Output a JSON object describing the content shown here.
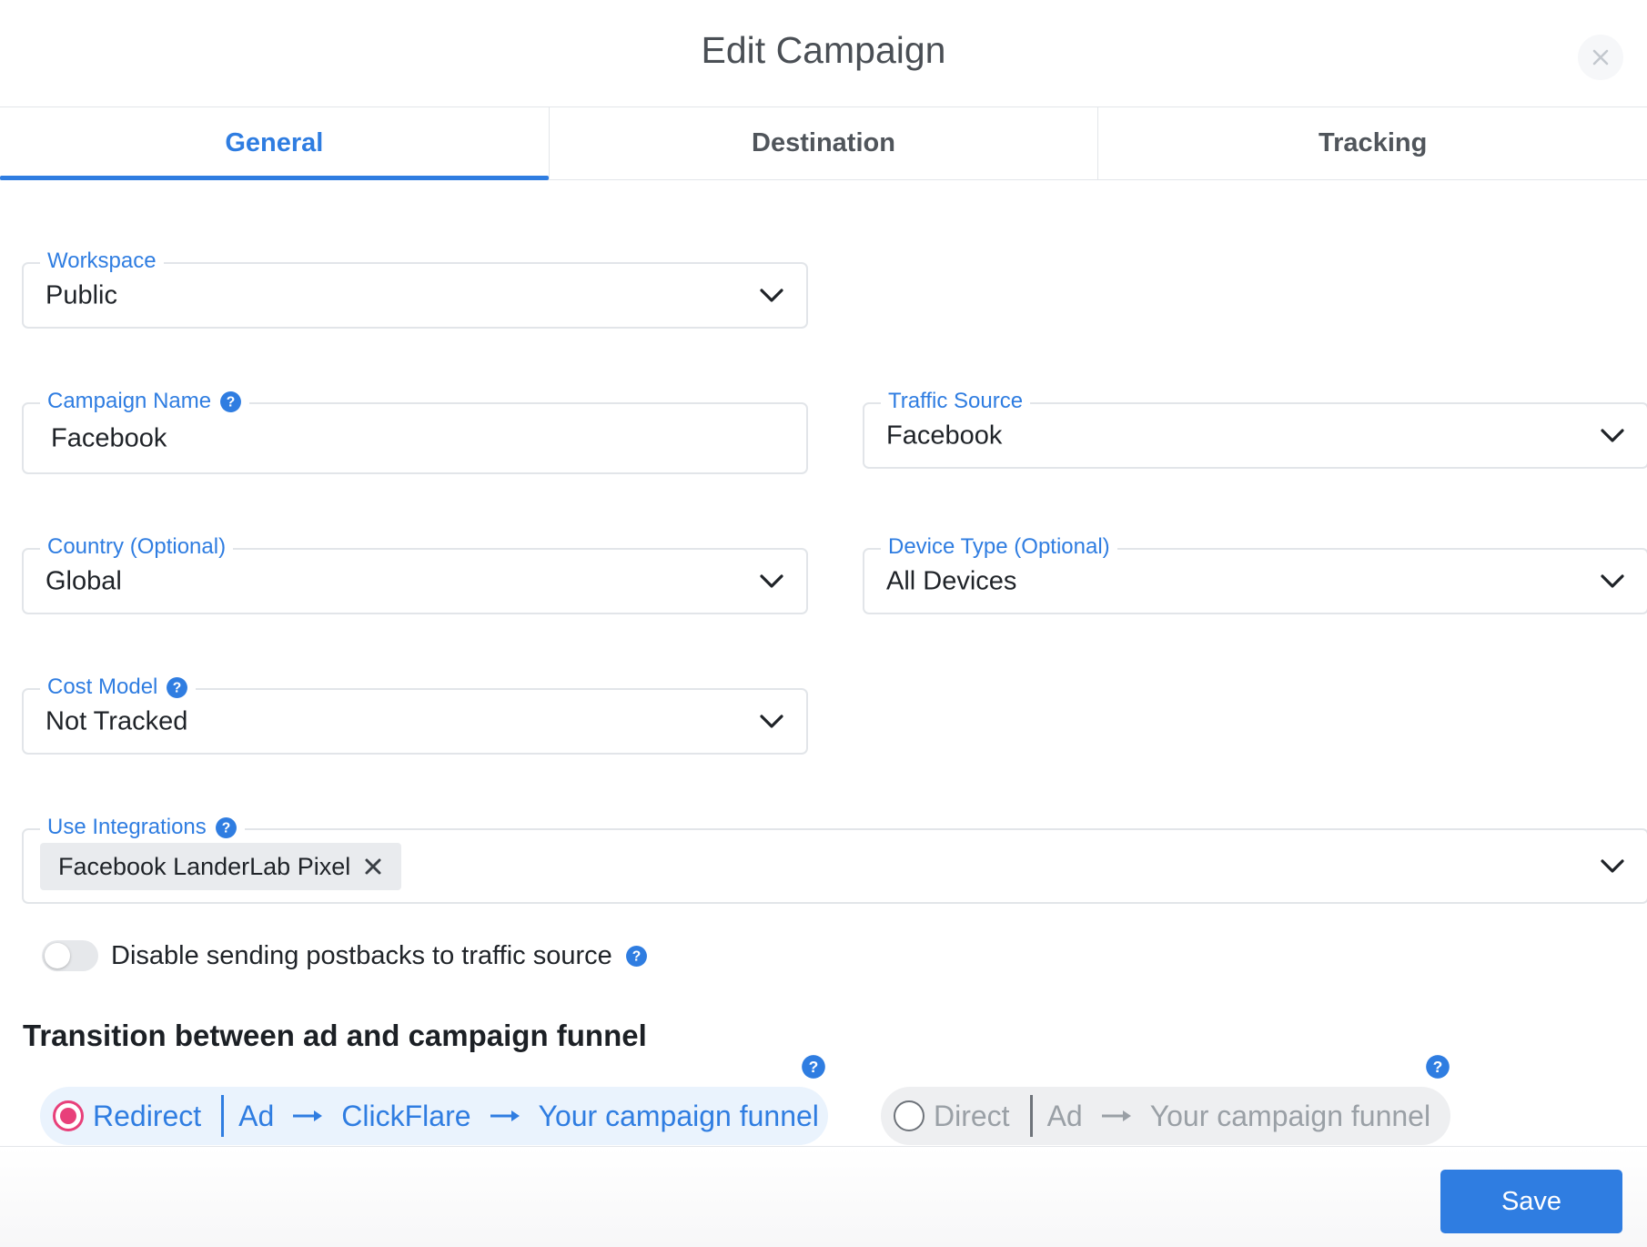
{
  "modal": {
    "title": "Edit Campaign"
  },
  "tabs": [
    {
      "label": "General",
      "active": true
    },
    {
      "label": "Destination",
      "active": false
    },
    {
      "label": "Tracking",
      "active": false
    }
  ],
  "fields": {
    "workspace": {
      "label": "Workspace",
      "value": "Public"
    },
    "campaign_name": {
      "label": "Campaign Name",
      "value": "Facebook"
    },
    "traffic_source": {
      "label": "Traffic Source",
      "value": "Facebook"
    },
    "country": {
      "label": "Country (Optional)",
      "value": "Global"
    },
    "device_type": {
      "label": "Device Type (Optional)",
      "value": "All Devices"
    },
    "cost_model": {
      "label": "Cost Model",
      "value": "Not Tracked"
    },
    "integrations": {
      "label": "Use Integrations",
      "chips": [
        "Facebook LanderLab Pixel"
      ]
    }
  },
  "postbacks_toggle": {
    "label": "Disable sending postbacks to traffic source",
    "enabled": false
  },
  "transition": {
    "title": "Transition between ad and campaign funnel",
    "redirect": {
      "label": "Redirect",
      "flow": [
        "Ad",
        "ClickFlare",
        "Your campaign funnel"
      ],
      "selected": true
    },
    "direct": {
      "label": "Direct",
      "flow": [
        "Ad",
        "Your campaign funnel"
      ],
      "selected": false
    }
  },
  "footer": {
    "save_label": "Save"
  },
  "colors": {
    "accent": "#2f7de1",
    "radio_selected": "#e8407a",
    "label": "#2f7de1"
  }
}
